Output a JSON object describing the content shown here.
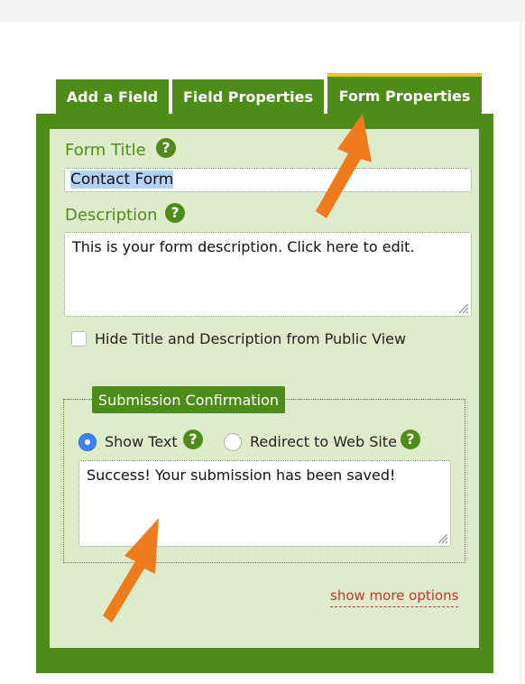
{
  "tabs": [
    {
      "label": "Add a Field"
    },
    {
      "label": "Field Properties"
    },
    {
      "label": "Form Properties",
      "active": true
    }
  ],
  "form_title": {
    "label": "Form Title",
    "help": "?",
    "value": "Contact Form",
    "selected": true
  },
  "description": {
    "label": "Description",
    "help": "?",
    "value": "This is your form description. Click here to edit."
  },
  "hide_option": {
    "label": "Hide Title and Description from Public View",
    "checked": false
  },
  "confirmation": {
    "legend": "Submission Confirmation",
    "option_text": {
      "label": "Show Text",
      "help": "?",
      "checked": true
    },
    "option_redirect": {
      "label": "Redirect to Web Site",
      "help": "?",
      "checked": false
    },
    "message": "Success! Your submission has been saved!"
  },
  "more_options": "show more options",
  "colors": {
    "green": "#4e8c1a",
    "panel_bg": "#dfeccb",
    "tab_accent": "#f2c318",
    "link": "#c0392b",
    "arrow": "#f07b1d",
    "radio_on": "#3b82f6"
  },
  "icons": [
    "help-icon",
    "arrow-pointer-icon",
    "resize-grip-icon"
  ]
}
